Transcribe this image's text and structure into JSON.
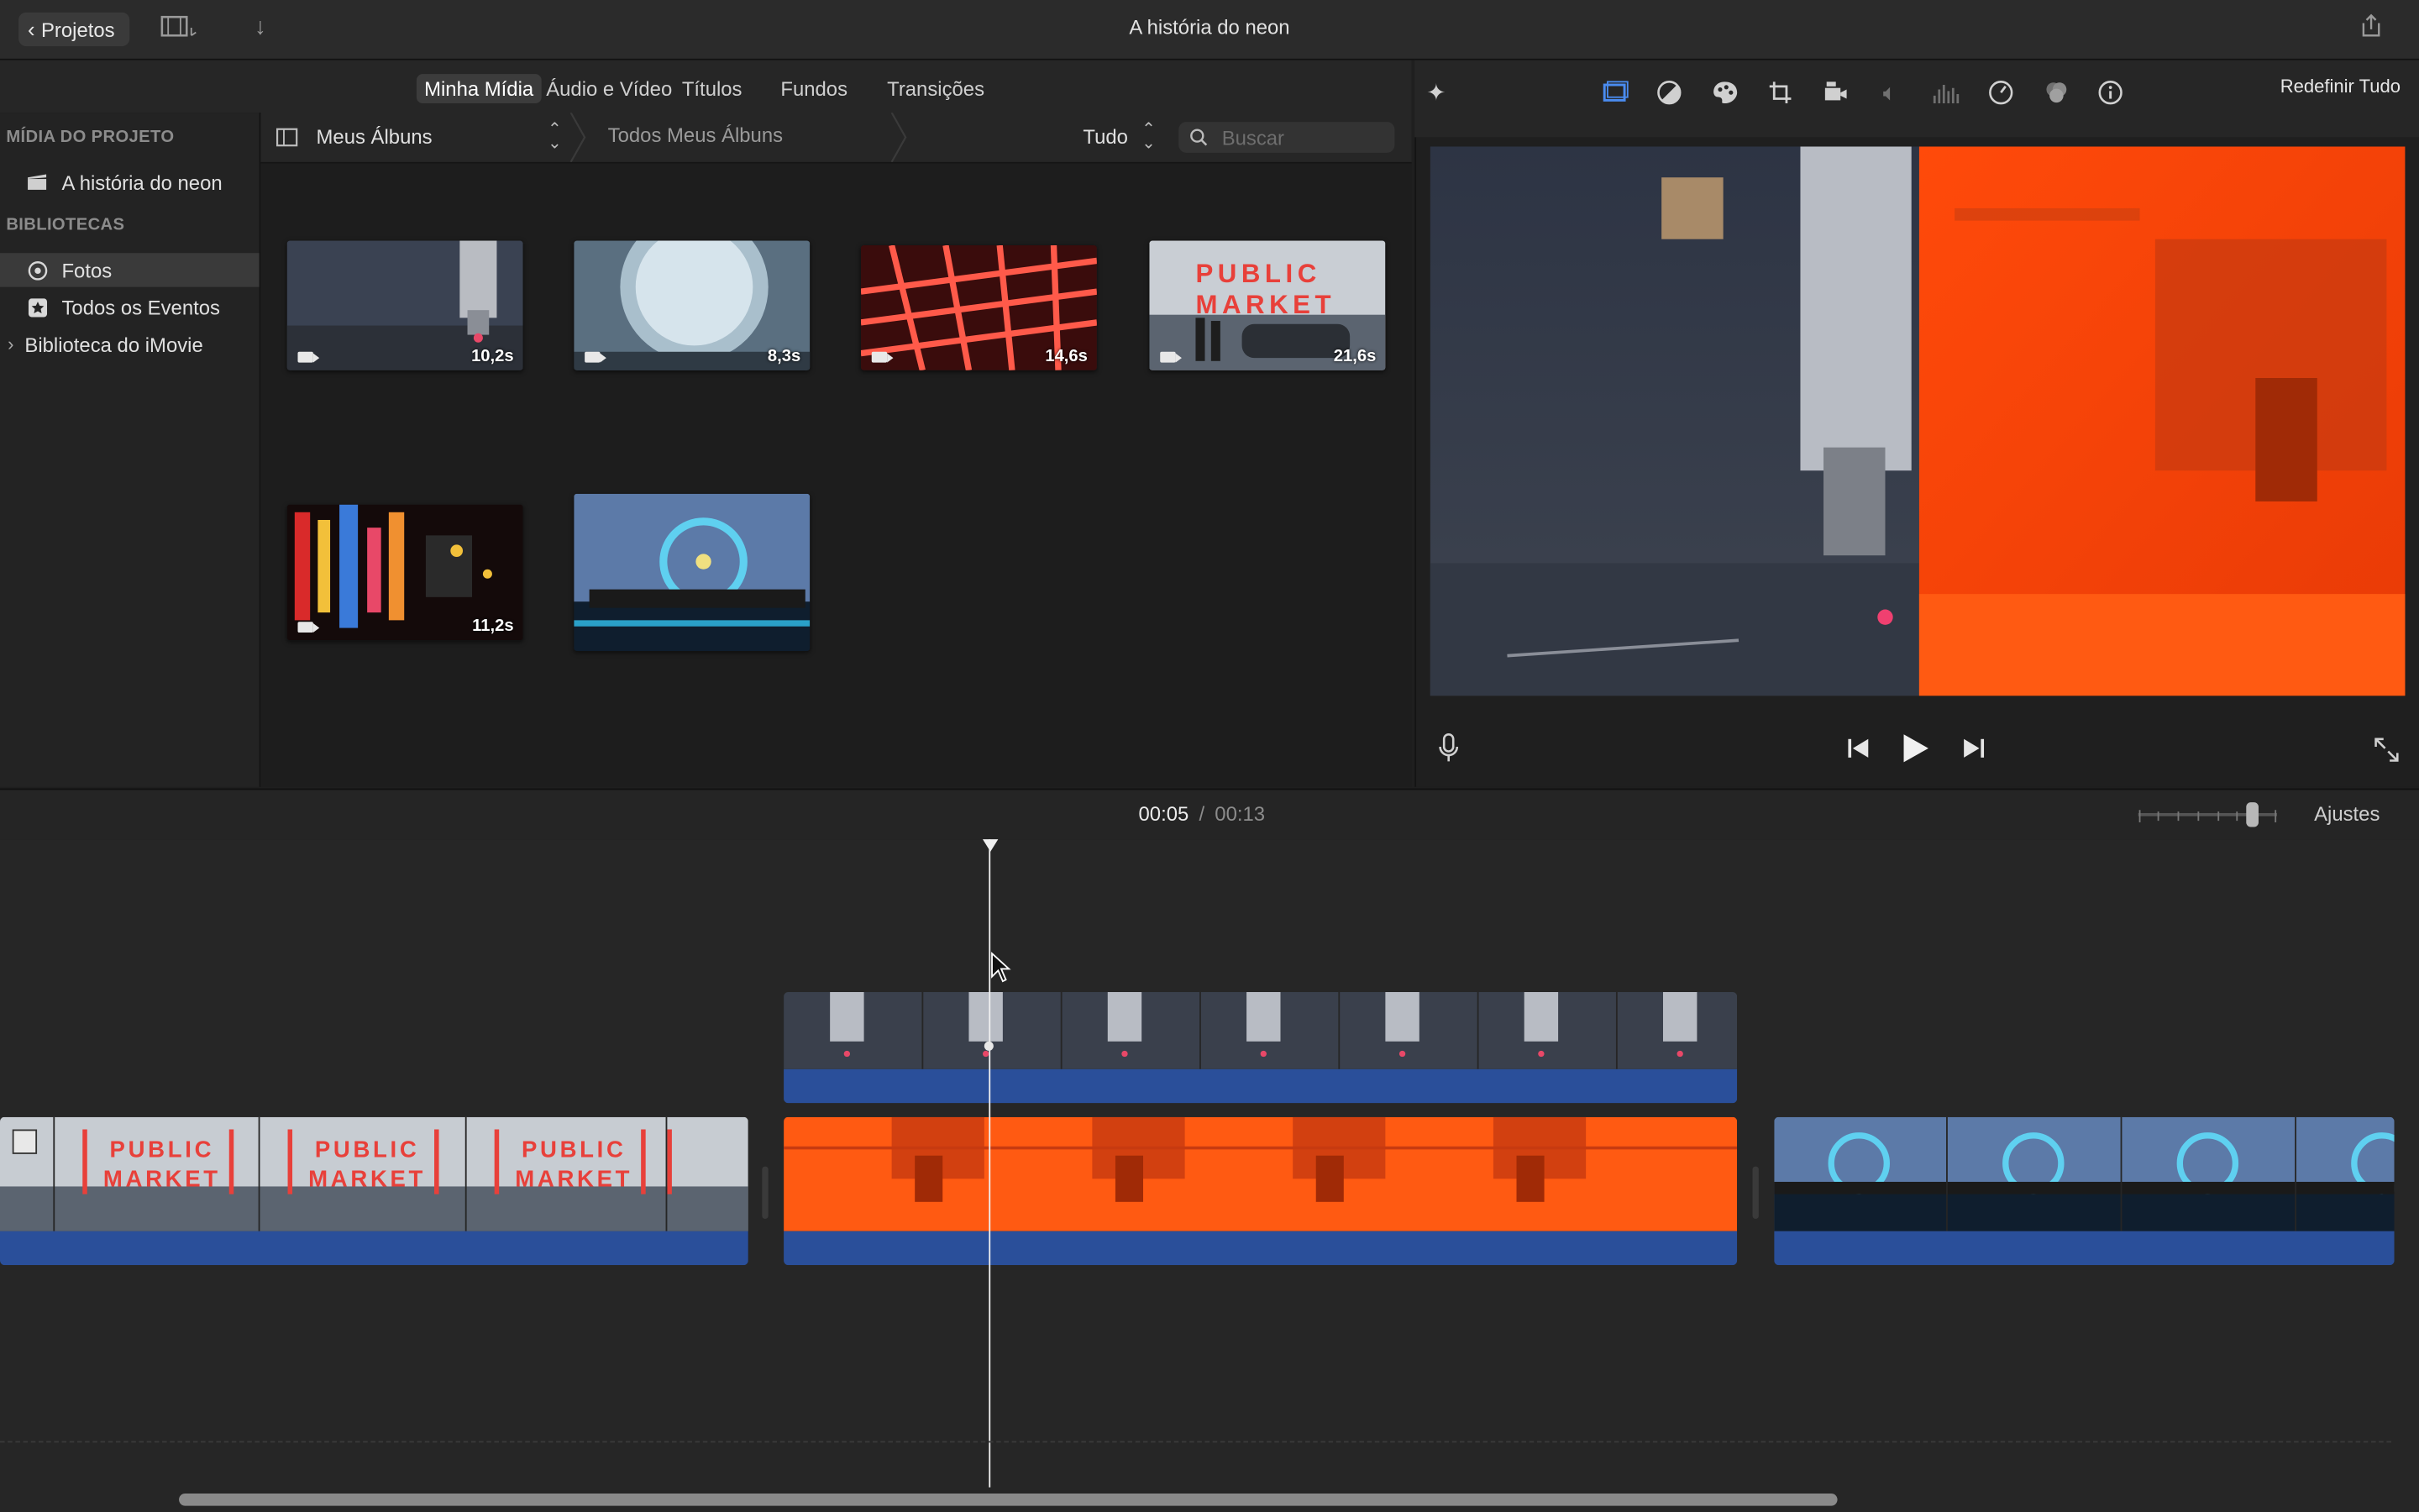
{
  "window": {
    "title": "A história do neon",
    "back_label": "Projetos"
  },
  "tabs": [
    "Minha Mídia",
    "Áudio e Vídeo",
    "Títulos",
    "Fundos",
    "Transições"
  ],
  "sidebar": {
    "section_project": "MÍDIA DO PROJETO",
    "project_item": "A história do neon",
    "section_libraries": "BIBLIOTECAS",
    "items": [
      "Fotos",
      "Todos os Eventos",
      "Biblioteca do iMovie"
    ]
  },
  "filter": {
    "album_select": "Meus Álbuns",
    "breadcrumb": "Todos Meus Álbuns",
    "show_select": "Tudo",
    "search_placeholder": "Buscar"
  },
  "media": [
    {
      "duration": "10,2s"
    },
    {
      "duration": "8,3s"
    },
    {
      "duration": "14,6s"
    },
    {
      "duration": "21,6s",
      "sign_text": "PUBLIC MARKET"
    },
    {
      "duration": "11,2s"
    },
    {
      "duration": ""
    }
  ],
  "viewer": {
    "reset_label": "Redefinir Tudo"
  },
  "timeline": {
    "current_time": "00:05",
    "separator": "/",
    "total_time": "00:13",
    "settings_label": "Ajustes",
    "clip_sign_text": "PUBLIC MARKET"
  },
  "colors": {
    "accent_blue": "#2a4f9a",
    "neon_red": "#e8403a",
    "neon_orange": "#ff5a12"
  }
}
